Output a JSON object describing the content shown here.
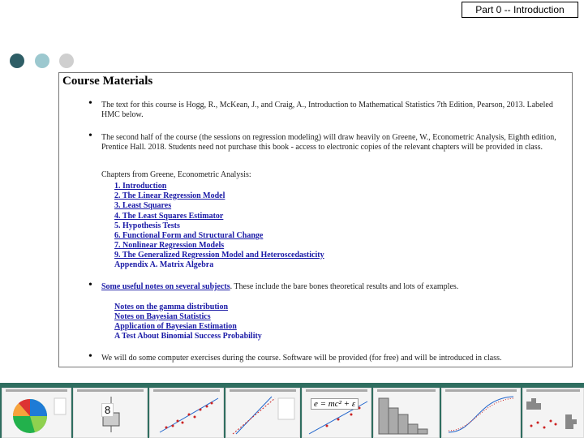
{
  "header": {
    "part_label": "Part 0 -- Introduction"
  },
  "panel": {
    "title": "Course Materials",
    "bullet_glyph": "•",
    "p1": "The text for this course is Hogg, R., McKean, J., and Craig, A., Introduction to Mathematical Statistics 7th Edition, Pearson, 2013. Labeled HMC below.",
    "p2": "The second half of the course (the sessions on regression modeling) will draw heavily on Greene, W., Econometric Analysis, Eighth edition, Prentice Hall. 2018. Students need not purchase this book - access to electronic copies of the relevant chapters will be provided in class.",
    "chapters_label": "Chapters from Greene, Econometric Analysis:",
    "chapters": [
      "1. Introduction",
      "2. The Linear Regression Model",
      "3. Least Squares",
      "4. The Least Squares Estimator",
      "5. Hypothesis Tests",
      "6. Functional Form and Structural Change",
      "7. Nonlinear Regression Models",
      "9. The Generalized Regression Model and Heteroscedasticity",
      "Appendix A. Matrix Algebra"
    ],
    "notes_link": "Some useful notes on several subjects",
    "notes_text": ". These include the bare bones theoretical results and lots of examples.",
    "notes": [
      "Notes on the gamma distribution",
      "Notes on Bayesian Statistics",
      "Application of Bayesian Estimation",
      "A Test About Binomial Success Probability"
    ],
    "p4": "We will do some computer exercises during the course. Software will be provided (for free) and will be introduced in class."
  },
  "thumbs": {
    "box_number": "8",
    "equation": "e = mc² + ε"
  },
  "colors": {
    "accent_dark": "#2e5e66",
    "accent_light": "#9cc8cf",
    "strip": "#2f6e60",
    "link": "#1a1aa6"
  }
}
